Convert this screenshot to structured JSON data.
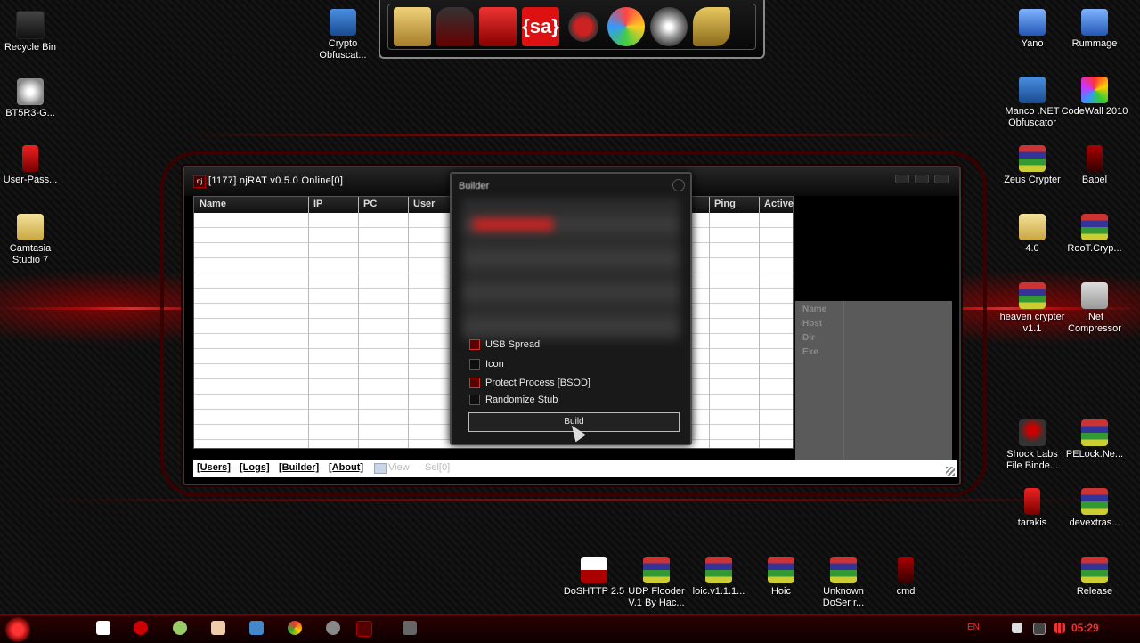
{
  "desktop": {
    "left_icons": [
      {
        "label": "Recycle Bin",
        "icon": "recycle-bin-icon"
      },
      {
        "label": "BT5R3-G...",
        "icon": "disc-image-icon"
      },
      {
        "label": "User-Pass...",
        "icon": "text-file-icon"
      },
      {
        "label": "Camtasia Studio 7",
        "icon": "camtasia-icon"
      }
    ],
    "top_icons": [
      {
        "label": "Crypto Obfuscat...",
        "icon": "shield-icon"
      }
    ],
    "right_icons": [
      {
        "label": "Yano",
        "icon": "yano-icon"
      },
      {
        "label": "Rummage",
        "icon": "rummage-icon"
      },
      {
        "label": "Manco .NET Obfuscator",
        "icon": "shield-icon"
      },
      {
        "label": "CodeWall 2010",
        "icon": "butterfly-icon"
      },
      {
        "label": "Zeus Crypter",
        "icon": "winrar-icon"
      },
      {
        "label": "Babel",
        "icon": "text-file-icon"
      },
      {
        "label": "4.0",
        "icon": "folder-icon"
      },
      {
        "label": "RooT.Cryp...",
        "icon": "winrar-icon"
      },
      {
        "label": "heaven crypter v1.1",
        "icon": "winrar-icon"
      },
      {
        "label": ".Net Compressor",
        "icon": "funnel-icon"
      },
      {
        "label": "Shock Labs File Binde...",
        "icon": "skull-icon"
      },
      {
        "label": "PELock.Ne...",
        "icon": "winrar-icon"
      },
      {
        "label": "tarakis",
        "icon": "text-file-icon"
      },
      {
        "label": "devextras...",
        "icon": "winrar-icon"
      },
      {
        "label": "Release",
        "icon": "winrar-icon"
      }
    ],
    "bottom_icons": [
      {
        "label": "DoSHTTP 2.5",
        "icon": "doshttp-icon"
      },
      {
        "label": "UDP Flooder V.1 By Hac...",
        "icon": "winrar-icon"
      },
      {
        "label": "loic.v1.1.1...",
        "icon": "winrar-icon"
      },
      {
        "label": "Hoic",
        "icon": "winrar-icon"
      },
      {
        "label": "Unknown DoSer r...",
        "icon": "winrar-icon"
      },
      {
        "label": "cmd",
        "icon": "cmd-icon"
      }
    ]
  },
  "dock": {
    "items": [
      "folder-user-icon",
      "car-icon",
      "computer-icon",
      "sa-icon",
      "gears-icon",
      "butterfly-icon",
      "disc-icon",
      "keys-icon"
    ],
    "sa_text": "{sa}"
  },
  "njrat": {
    "title": "[1177] njRAT v0.5.0 Online[0]",
    "columns": [
      "Name",
      "IP",
      "PC",
      "User",
      "Ping",
      "Active"
    ],
    "info_labels": [
      "Name",
      "Host",
      "Dir",
      "Exe"
    ],
    "menu": [
      "[Users]",
      "[Logs]",
      "[Builder]",
      "[About]"
    ],
    "menu_disabled": [
      "View",
      "Sel[0]"
    ]
  },
  "builder": {
    "title": "Builder",
    "options": [
      {
        "label": "USB Spread",
        "checked": true
      },
      {
        "label": "Icon",
        "checked": false
      },
      {
        "label": "Protect Process [BSOD]",
        "checked": true
      },
      {
        "label": "Randomize Stub",
        "checked": false
      }
    ],
    "build_label": "Build"
  },
  "taskbar": {
    "lang": "EN",
    "clock": "05:29"
  },
  "colors": {
    "accent": "#cc0000",
    "bg": "#0c0c0c"
  }
}
